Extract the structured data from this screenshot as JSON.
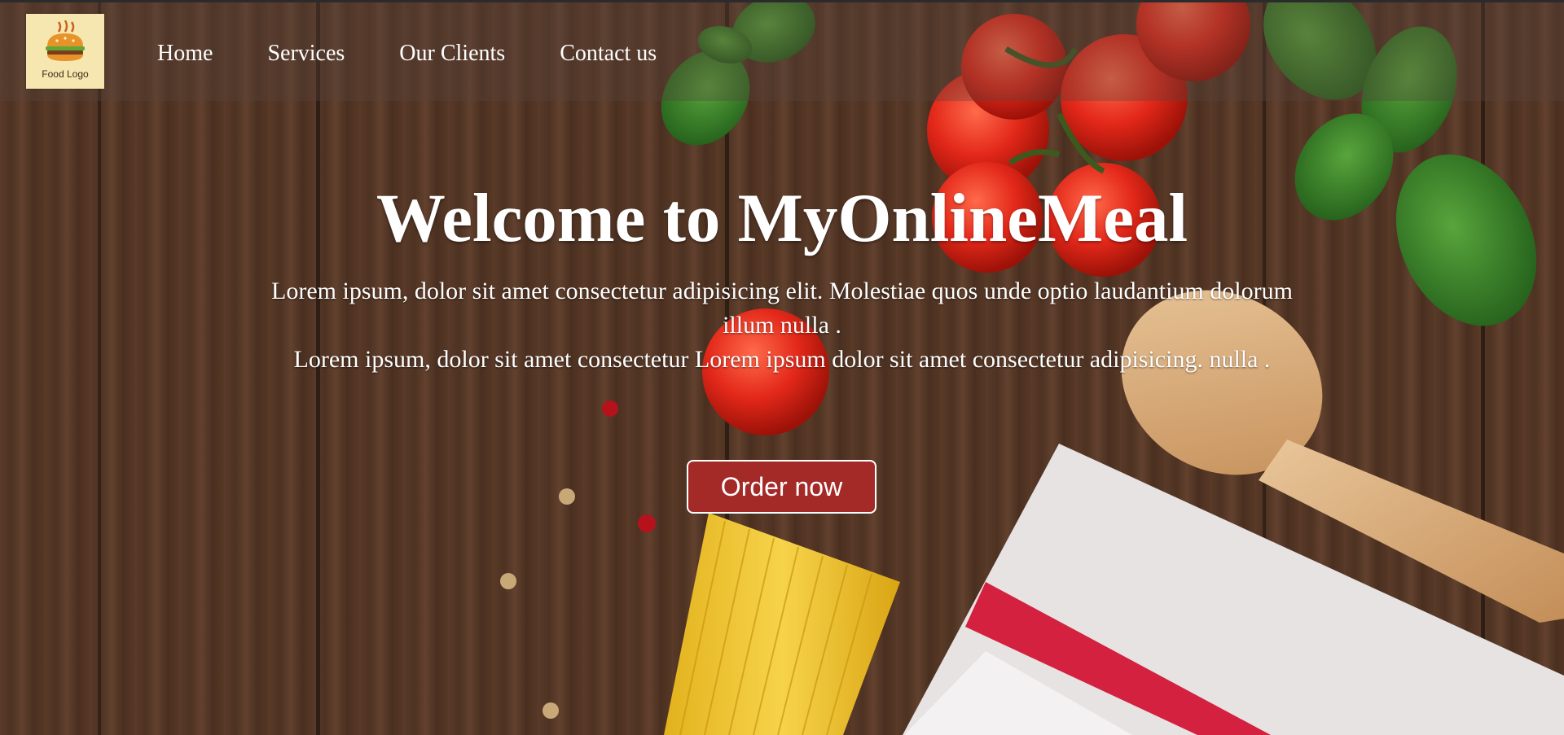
{
  "logo": {
    "text": "Food Logo",
    "icon": "burger-icon"
  },
  "nav": {
    "items": [
      {
        "label": "Home"
      },
      {
        "label": "Services"
      },
      {
        "label": "Our Clients"
      },
      {
        "label": "Contact us"
      }
    ]
  },
  "hero": {
    "title": "Welcome to MyOnlineMeal",
    "paragraph_1": "Lorem ipsum, dolor sit amet consectetur adipisicing elit. Molestiae quos unde optio laudantium dolorum illum nulla .",
    "paragraph_2": "Lorem ipsum, dolor sit amet consectetur Lorem ipsum dolor sit amet consectetur adipisicing. nulla .",
    "cta_label": "Order now",
    "background_image": "food-table-photo"
  },
  "colors": {
    "button_bg": "#a42a28",
    "text": "#ffffff",
    "logo_bg": "#f6e7b0"
  }
}
